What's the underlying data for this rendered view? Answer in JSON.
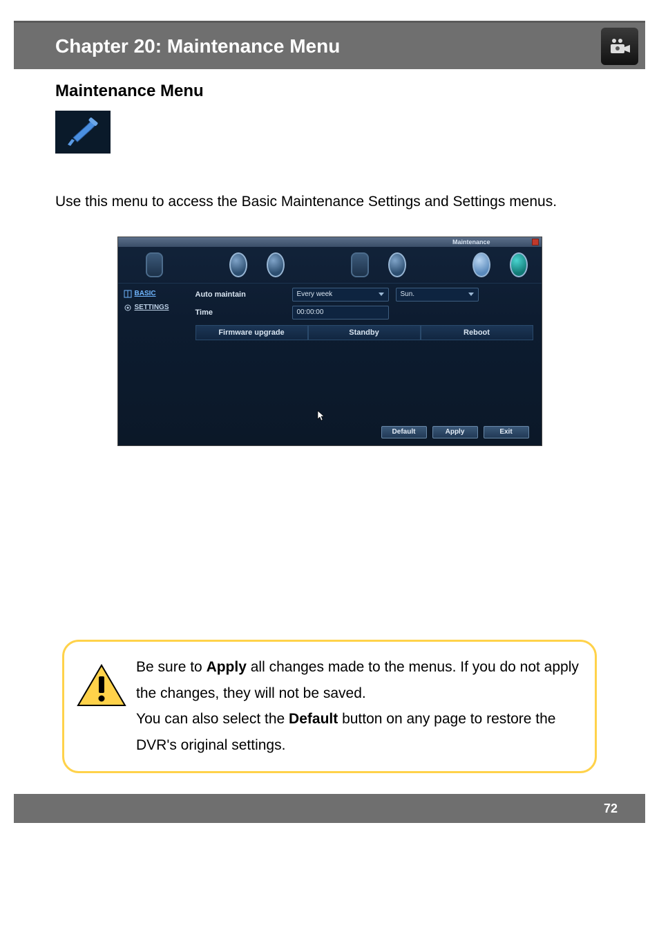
{
  "header": {
    "chapter_title": "Chapter 20: Maintenance Menu"
  },
  "section": {
    "title": "Maintenance Menu",
    "intro": "Use this menu to access the Basic Maintenance Settings and Settings menus."
  },
  "screenshot": {
    "titlebar_label": "Maintenance",
    "sidebar": {
      "items": [
        {
          "label": "BASIC"
        },
        {
          "label": "SETTINGS"
        }
      ]
    },
    "form": {
      "auto_maintain_label": "Auto maintain",
      "frequency_value": "Every week",
      "day_value": "Sun.",
      "time_label": "Time",
      "time_value": "00:00:00"
    },
    "action_buttons": {
      "firmware": "Firmware upgrade",
      "standby": "Standby",
      "reboot": "Reboot"
    },
    "footer_buttons": {
      "default": "Default",
      "apply": "Apply",
      "exit": "Exit"
    }
  },
  "tip": {
    "line1_pre": "Be sure to ",
    "line1_bold": "Apply",
    "line1_post": " all changes made to the menus. If you do not apply the changes, they will not be saved.",
    "line2_pre": "You can also select the ",
    "line2_bold": "Default",
    "line2_post": " button on any page to restore the DVR's original settings."
  },
  "footer": {
    "page_number": "72"
  }
}
